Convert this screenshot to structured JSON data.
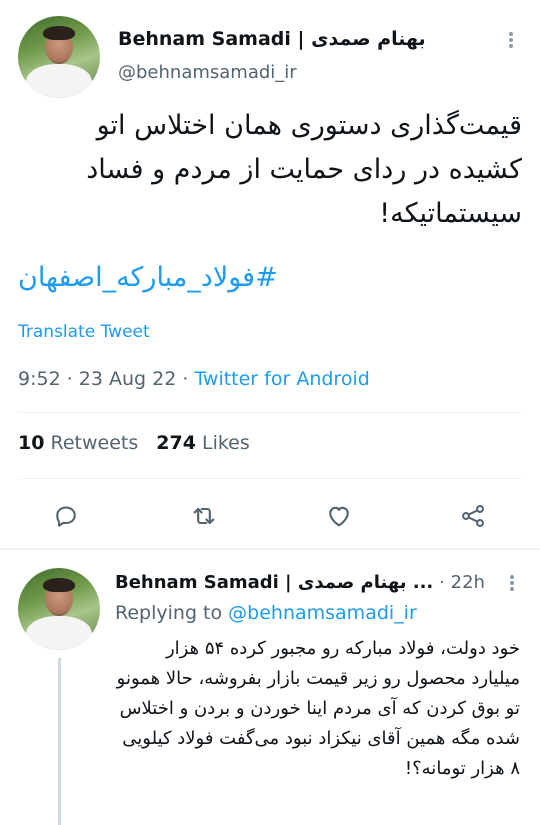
{
  "tweet": {
    "display_name": "Behnam Samadi | بهنام صمدی",
    "handle": "@behnamsamadi_ir",
    "text": "قیمت‌گذاری دستوری همان اختلاس اتو کشیده در ردای حمایت از مردم و فساد سیستماتیکه!",
    "hashtag": "#فولاد_مبارکه_اصفهان",
    "translate_label": "Translate Tweet",
    "time": "9:52 · 23 Aug 22 · ",
    "source": "Twitter for Android",
    "retweets_count": "10",
    "retweets_label": "Retweets",
    "likes_count": "274",
    "likes_label": "Likes"
  },
  "reply": {
    "display_name": "Behnam Samadi | بهنام صمدی ...",
    "dot": "·",
    "time": "22h",
    "replying_prefix": "Replying to ",
    "replying_handle": "@behnamsamadi_ir",
    "text": "خود دولت، فولاد مبارکه رو مجبور کرده ۵۴ هزار میلیارد محصول رو زیر قیمت بازار بفروشه، حالا همونو تو بوق کردن که آی مردم اینا خوردن و بردن و اختلاس شده مگه همین آقای نیکزاد نبود می‌گفت فولاد کیلویی ۸ هزار تومانه؟!"
  },
  "icons": {
    "more": "more-vertical-icon",
    "reply": "comment-icon",
    "retweet": "retweet-icon",
    "like": "heart-icon",
    "share": "share-icon"
  },
  "colors": {
    "accent": "#1d9bf0",
    "secondary_text": "#536471",
    "primary_text": "#0f1419"
  }
}
